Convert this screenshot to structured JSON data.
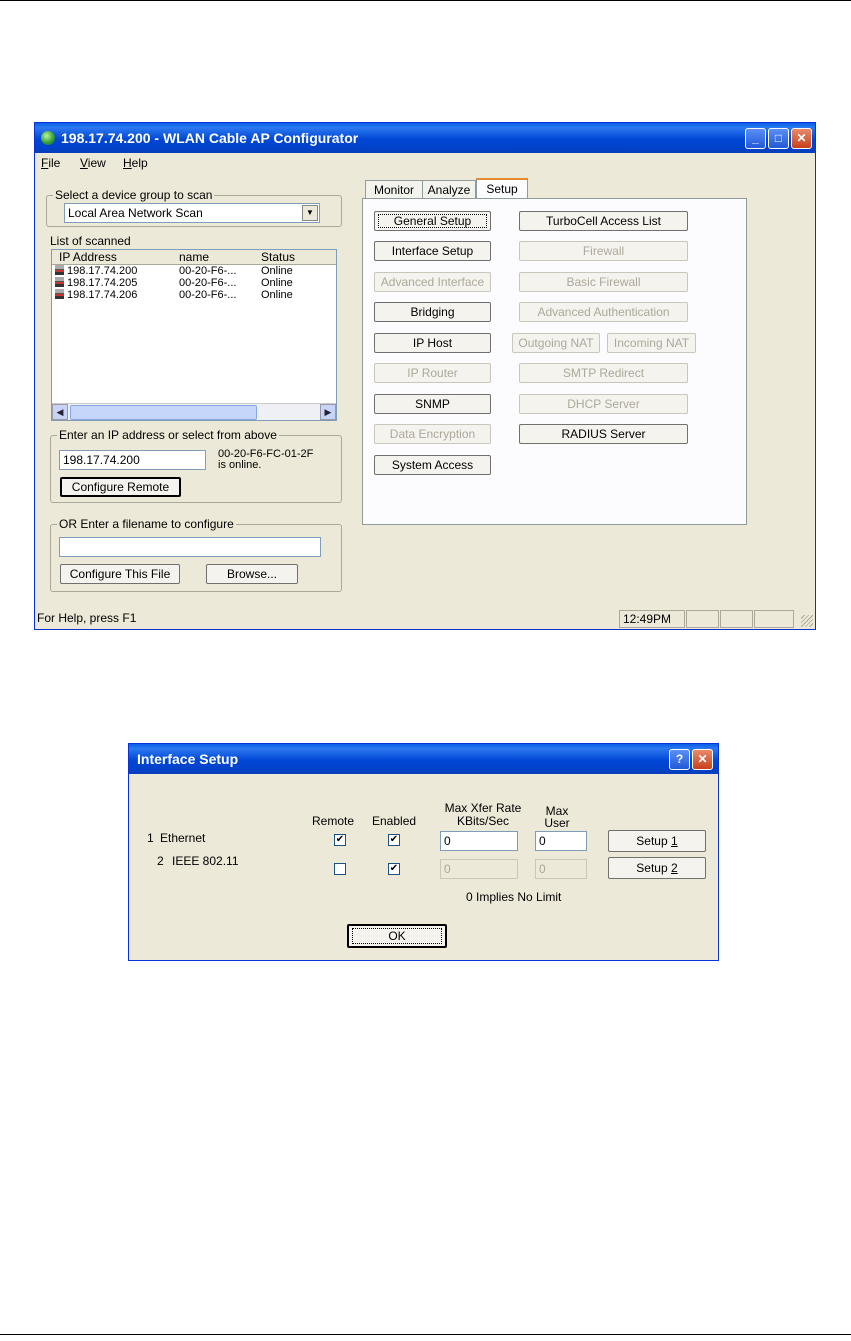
{
  "main_window": {
    "title": "198.17.74.200 - WLAN Cable AP Configurator",
    "menu": [
      {
        "key": "F",
        "rest": "ile"
      },
      {
        "key": "V",
        "rest": "iew"
      },
      {
        "key": "H",
        "rest": "elp"
      }
    ],
    "scan_group": {
      "legend": "Select a device group to scan",
      "selected": "Local Area Network Scan"
    },
    "list": {
      "label": "List of scanned",
      "columns": [
        "IP Address",
        "name",
        "Status"
      ],
      "rows": [
        {
          "ip": "198.17.74.200",
          "name": "00-20-F6-...",
          "status": "Online"
        },
        {
          "ip": "198.17.74.205",
          "name": "00-20-F6-...",
          "status": "Online"
        },
        {
          "ip": "198.17.74.206",
          "name": "00-20-F6-...",
          "status": "Online"
        }
      ]
    },
    "ip_group": {
      "legend": "Enter an IP address or select from above",
      "ip_value": "198.17.74.200",
      "info_line1": "00-20-F6-FC-01-2F",
      "info_line2": "is online.",
      "configure_remote": "Configure Remote"
    },
    "file_group": {
      "legend": "OR Enter a filename to configure",
      "filename_value": "",
      "configure_file": "Configure This File",
      "browse": "Browse..."
    },
    "tabs": [
      "Monitor",
      "Analyze",
      "Setup"
    ],
    "active_tab": "Setup",
    "setup_buttons": {
      "general_setup": "General Setup",
      "interface_setup": "Interface Setup",
      "advanced_interface": "Advanced Interface",
      "bridging": "Bridging",
      "ip_host": "IP Host",
      "ip_router": "IP Router",
      "snmp": "SNMP",
      "data_encryption": "Data Encryption",
      "system_access": "System Access",
      "turbocell_access_list": "TurboCell Access List",
      "firewall": "Firewall",
      "basic_firewall": "Basic Firewall",
      "advanced_authentication": "Advanced Authentication",
      "outgoing_nat": "Outgoing NAT",
      "incoming_nat": "Incoming NAT",
      "smtp_redirect": "SMTP Redirect",
      "dhcp_server": "DHCP Server",
      "radius_server": "RADIUS Server"
    },
    "status": {
      "help_text": "For Help, press F1",
      "time": "12:49PM"
    }
  },
  "dialog": {
    "title": "Interface Setup",
    "headers": {
      "remote": "Remote",
      "enabled": "Enabled",
      "rate_line1": "Max Xfer Rate",
      "rate_line2": "KBits/Sec",
      "max_line1": "Max",
      "max_line2": "User"
    },
    "rows": [
      {
        "num": "1",
        "name": "Ethernet",
        "remote": true,
        "enabled": true,
        "rate": "0",
        "max_user": "0",
        "setup_prefix": "Setup ",
        "setup_key": "1"
      },
      {
        "num": "2",
        "name": "IEEE 802.11",
        "remote": false,
        "enabled": true,
        "rate": "0",
        "max_user": "0",
        "setup_prefix": "Setup ",
        "setup_key": "2"
      }
    ],
    "note": "0 Implies No Limit",
    "ok": "OK"
  }
}
